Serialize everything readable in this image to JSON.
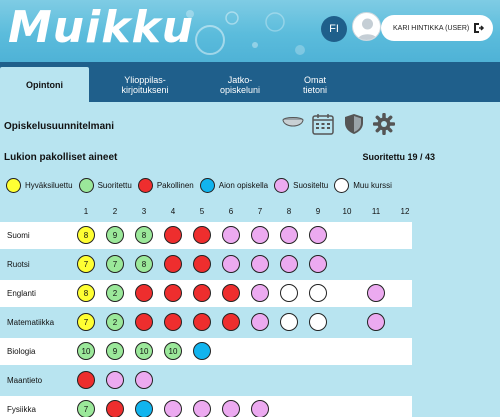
{
  "app": {
    "logo": "Muikku"
  },
  "header": {
    "lang": "FI",
    "user": "KARI HINTIKKA (USER)"
  },
  "tabs": [
    {
      "label": "Opintoni",
      "active": true
    },
    {
      "label": "Ylioppilas-\nkirjoitukseni",
      "active": false
    },
    {
      "label": "Jatko-\nopiskeluni",
      "active": false
    },
    {
      "label": "Omat\ntietoni",
      "active": false
    }
  ],
  "section": {
    "title": "Opiskelusuunnitelmani"
  },
  "subsection": {
    "title": "Lukion pakolliset aineet",
    "progress": "Suoritettu 19 / 43"
  },
  "colors": {
    "yellow": "#ffff33",
    "green": "#9be89a",
    "red": "#ee2e2e",
    "blue": "#11b4ee",
    "pink": "#ecaaf0",
    "white": "#ffffff",
    "nav": "#1f5f8b",
    "background": "#b8e4f0"
  },
  "legend": [
    {
      "label": "Hyväksiluettu",
      "color": "yellow"
    },
    {
      "label": "Suoritettu",
      "color": "green"
    },
    {
      "label": "Pakollinen",
      "color": "red"
    },
    {
      "label": "Aion opiskella",
      "color": "blue"
    },
    {
      "label": "Suositeltu",
      "color": "pink"
    },
    {
      "label": "Muu kurssi",
      "color": "white"
    }
  ],
  "columns": [
    "1",
    "2",
    "3",
    "4",
    "5",
    "6",
    "7",
    "8",
    "9",
    "10",
    "11",
    "12"
  ],
  "subjects": [
    {
      "name": "Suomi",
      "courses": [
        {
          "c": "yellow",
          "t": "8"
        },
        {
          "c": "green",
          "t": "9"
        },
        {
          "c": "green",
          "t": "8"
        },
        {
          "c": "red",
          "t": ""
        },
        {
          "c": "red",
          "t": ""
        },
        {
          "c": "pink",
          "t": ""
        },
        {
          "c": "pink",
          "t": ""
        },
        {
          "c": "pink",
          "t": ""
        },
        {
          "c": "pink",
          "t": ""
        }
      ]
    },
    {
      "name": "Ruotsi",
      "courses": [
        {
          "c": "yellow",
          "t": "7"
        },
        {
          "c": "green",
          "t": "7"
        },
        {
          "c": "green",
          "t": "8"
        },
        {
          "c": "red",
          "t": ""
        },
        {
          "c": "red",
          "t": ""
        },
        {
          "c": "pink",
          "t": ""
        },
        {
          "c": "pink",
          "t": ""
        },
        {
          "c": "pink",
          "t": ""
        },
        {
          "c": "pink",
          "t": ""
        }
      ]
    },
    {
      "name": "Englanti",
      "courses": [
        {
          "c": "yellow",
          "t": "8"
        },
        {
          "c": "green",
          "t": "2"
        },
        {
          "c": "red",
          "t": ""
        },
        {
          "c": "red",
          "t": ""
        },
        {
          "c": "red",
          "t": ""
        },
        {
          "c": "red",
          "t": ""
        },
        {
          "c": "pink",
          "t": ""
        },
        {
          "c": "white",
          "t": ""
        },
        {
          "c": "white",
          "t": ""
        },
        null,
        {
          "c": "pink",
          "t": ""
        }
      ]
    },
    {
      "name": "Matematiikka",
      "courses": [
        {
          "c": "yellow",
          "t": "7"
        },
        {
          "c": "green",
          "t": "2"
        },
        {
          "c": "red",
          "t": ""
        },
        {
          "c": "red",
          "t": ""
        },
        {
          "c": "red",
          "t": ""
        },
        {
          "c": "red",
          "t": ""
        },
        {
          "c": "pink",
          "t": ""
        },
        {
          "c": "white",
          "t": ""
        },
        {
          "c": "white",
          "t": ""
        },
        null,
        {
          "c": "pink",
          "t": ""
        }
      ]
    },
    {
      "name": "Biologia",
      "courses": [
        {
          "c": "green",
          "t": "10"
        },
        {
          "c": "green",
          "t": "9"
        },
        {
          "c": "green",
          "t": "10"
        },
        {
          "c": "green",
          "t": "10"
        },
        {
          "c": "blue",
          "t": ""
        }
      ]
    },
    {
      "name": "Maantieto",
      "courses": [
        {
          "c": "red",
          "t": ""
        },
        {
          "c": "pink",
          "t": ""
        },
        {
          "c": "pink",
          "t": ""
        }
      ]
    },
    {
      "name": "Fysiikka",
      "courses": [
        {
          "c": "green",
          "t": "7"
        },
        {
          "c": "red",
          "t": ""
        },
        {
          "c": "blue",
          "t": ""
        },
        {
          "c": "pink",
          "t": ""
        },
        {
          "c": "pink",
          "t": ""
        },
        {
          "c": "pink",
          "t": ""
        },
        {
          "c": "pink",
          "t": ""
        }
      ]
    }
  ]
}
